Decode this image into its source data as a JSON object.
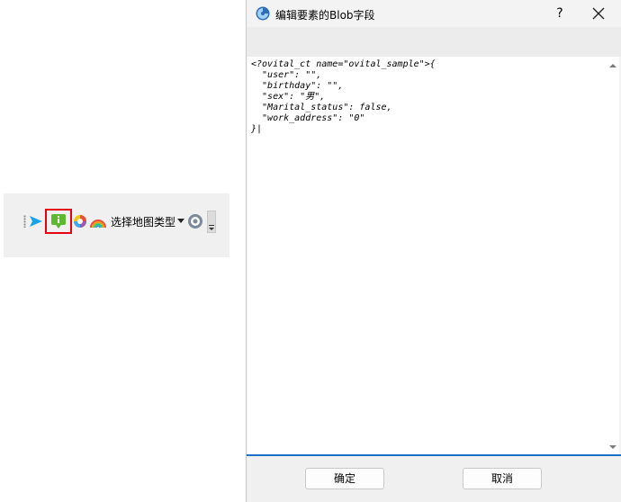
{
  "toolbar": {
    "map_type_label": "选择地图类型",
    "icons": [
      "send-icon",
      "info-marker-icon",
      "color-wheel-icon",
      "rainbow-icon",
      "dropdown-caret-icon",
      "settings-icon",
      "overflow-icon"
    ],
    "highlight_color": "#e60012"
  },
  "dialog": {
    "title": "编辑要素的Blob字段",
    "help_label": "?",
    "editor": {
      "content": "<?ovital_ct name=\"ovital_sample\">{\n  \"user\": \"\",\n  \"birthday\": \"\",\n  \"sex\": \"男\",\n  \"Marital_status\": false,\n  \"work_address\": \"0\"\n}|"
    },
    "ok_label": "确定",
    "cancel_label": "取消",
    "accent_color": "#1e6fc7"
  }
}
